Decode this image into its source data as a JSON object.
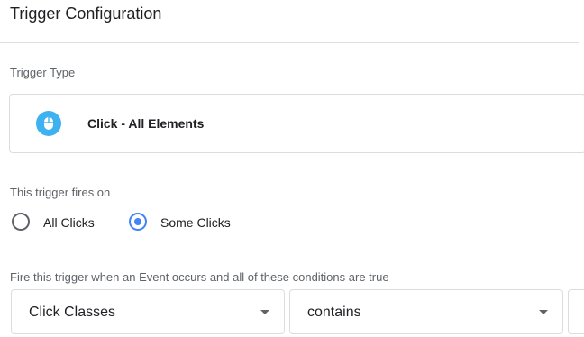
{
  "header": {
    "title": "Trigger Configuration"
  },
  "trigger_type": {
    "label": "Trigger Type",
    "selected": "Click - All Elements",
    "icon": "mouse-icon",
    "icon_color": "#3eb1f0"
  },
  "fires_on": {
    "label": "This trigger fires on",
    "options": [
      {
        "label": "All Clicks",
        "checked": false
      },
      {
        "label": "Some Clicks",
        "checked": true
      }
    ],
    "accent_color": "#4285f4"
  },
  "condition": {
    "label": "Fire this trigger when an Event occurs and all of these conditions are true",
    "variable": "Click Classes",
    "operator": "contains"
  }
}
